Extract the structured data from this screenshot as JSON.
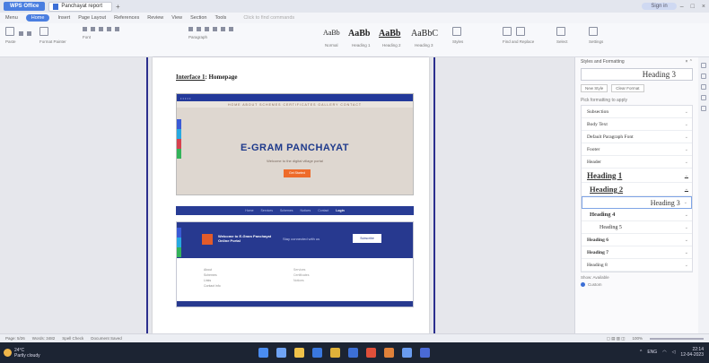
{
  "titlebar": {
    "app_label": "WPS Office",
    "doc_tab": "Panchayat report",
    "user_label": "Sign in"
  },
  "menubar": {
    "items": [
      "Menu",
      "Home",
      "Insert",
      "Page Layout",
      "References",
      "Review",
      "View",
      "Section",
      "Tools"
    ],
    "active": "Home",
    "search_placeholder": "Click to find commands"
  },
  "ribbon": {
    "style_samples": [
      {
        "sample": "AaBb",
        "caption": "Normal"
      },
      {
        "sample": "AaBb",
        "caption": "Heading 1"
      },
      {
        "sample": "AaBb",
        "caption": "Heading 2"
      },
      {
        "sample": "AaBbC",
        "caption": "Heading 3"
      }
    ],
    "group_labels": [
      "Paste",
      "Format Painter",
      "Font",
      "Paragraph",
      "Styles",
      "Find and Replace",
      "Select",
      "Settings"
    ]
  },
  "document": {
    "heading_prefix": "Interface 1",
    "heading_rest": ": Homepage",
    "screenshot1": {
      "nav_text": "• • • • •",
      "subnav": "HOME   ABOUT   SCHEMES   CERTIFICATES   GALLERY   CONTACT",
      "hero_title": "E-GRAM PANCHAYAT",
      "hero_subtitle": "Welcome to the digital village portal",
      "hero_button": "Get Started"
    },
    "screenshot2": {
      "strip_items": [
        "Home",
        "Services",
        "Schemes",
        "Notices",
        "Contact",
        "Login"
      ],
      "title_line1": "Welcome to E-Gram Panchayat",
      "title_line2": "Online Portal",
      "mid_text": "Stay connected with us",
      "button": "Subscribe",
      "col1": [
        "About",
        "Schemes",
        "Links",
        "Contact info"
      ],
      "col2": [
        "Services",
        "Certificates",
        "Notices"
      ]
    }
  },
  "panel": {
    "title": "Styles and Formatting",
    "current_style": "Heading 3",
    "buttons": [
      "New Style",
      "Clear Format"
    ],
    "pick_label": "Pick formatting to apply",
    "styles": [
      {
        "label": "Subsection",
        "cls": ""
      },
      {
        "label": "Body Text",
        "cls": ""
      },
      {
        "label": "Default Paragraph Font",
        "cls": ""
      },
      {
        "label": "Footer",
        "cls": ""
      },
      {
        "label": "Header",
        "cls": ""
      },
      {
        "label": "Heading 1",
        "cls": "h1"
      },
      {
        "label": "Heading 2",
        "cls": "h2"
      },
      {
        "label": "Heading 3",
        "cls": "h3"
      },
      {
        "label": "Heading 4",
        "cls": "h4"
      },
      {
        "label": "Heading 5",
        "cls": "h5"
      },
      {
        "label": "Heading 6",
        "cls": "small"
      },
      {
        "label": "Heading 7",
        "cls": "small"
      },
      {
        "label": "Heading 8",
        "cls": ""
      }
    ],
    "show_label": "Show: Available",
    "radio_label": "Custom"
  },
  "statusbar": {
    "page": "Page: 5/26",
    "words": "Words: 3482",
    "spell": "Spell Check",
    "doc_status": "Document Saved",
    "zoom": "100%"
  },
  "taskbar": {
    "weather_temp": "24°C",
    "weather_desc": "Partly cloudy",
    "lang": "ENG",
    "time": "22:14",
    "date": "12-04-2023",
    "app_colors": [
      "#4a8cf0",
      "#6fa3f5",
      "#f0c24a",
      "#3a78e0",
      "#e0b23a",
      "#3c6fd6",
      "#e04f3a",
      "#e0813a",
      "#6a9cf0",
      "#4a6ad6"
    ]
  }
}
